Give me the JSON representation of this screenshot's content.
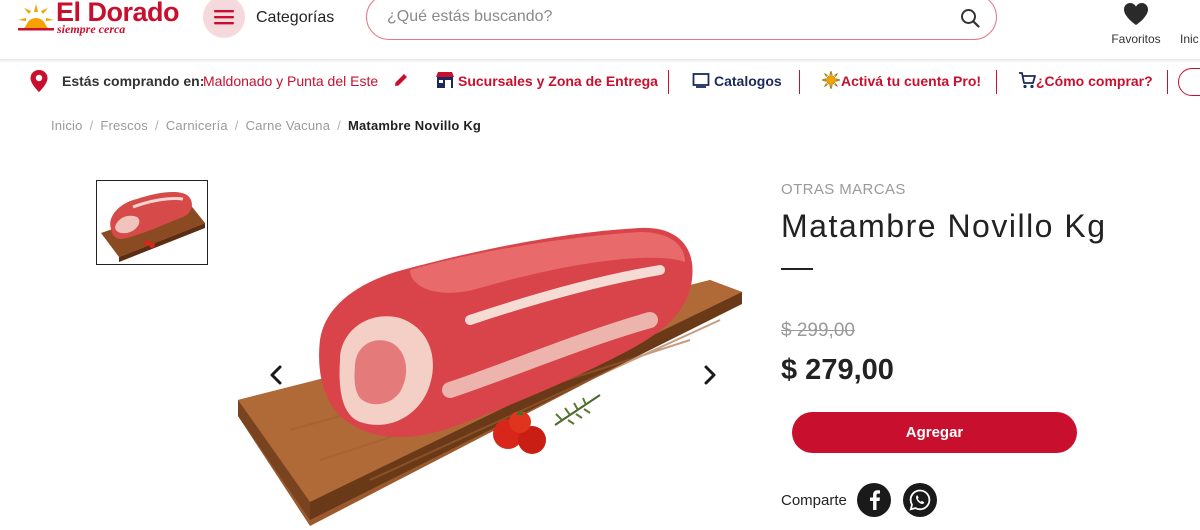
{
  "header": {
    "logo_name": "El Dorado",
    "logo_tagline": "siempre cerca",
    "menu_icon": "hamburger-icon",
    "categories_label": "Categorías",
    "search_placeholder": "¿Qué estás buscando?",
    "search_icon": "search-icon",
    "favorites_label": "Favoritos",
    "favorites_icon": "heart-icon",
    "home_label": "Inic"
  },
  "info_bar": {
    "location_prefix": "Estás comprando en:",
    "location_value": "Maldonado y Punta del Este",
    "links": [
      {
        "label": "Sucursales y Zona de Entrega",
        "icon": "store-icon"
      },
      {
        "label": "Catalogos",
        "icon": "catalog-icon"
      },
      {
        "label": "Activá tu cuenta Pro!",
        "icon": "sun-icon"
      },
      {
        "label": "¿Cómo comprar?",
        "icon": "cart-icon"
      }
    ]
  },
  "breadcrumb": {
    "items": [
      "Inicio",
      "Frescos",
      "Carnicería",
      "Carne Vacuna"
    ],
    "current": "Matambre Novillo Kg"
  },
  "product": {
    "brand": "OTRAS MARCAS",
    "title": "Matambre Novillo Kg",
    "old_price": "$ 299,00",
    "price": "$ 279,00",
    "add_button_label": "Agregar",
    "share_label": "Comparte",
    "share_icons": [
      "facebook-icon",
      "whatsapp-icon"
    ]
  },
  "colors": {
    "brand_red": "#c8102e",
    "brand_yellow": "#f5a100",
    "text_dark": "#222222",
    "text_muted": "#9a9a9a"
  }
}
